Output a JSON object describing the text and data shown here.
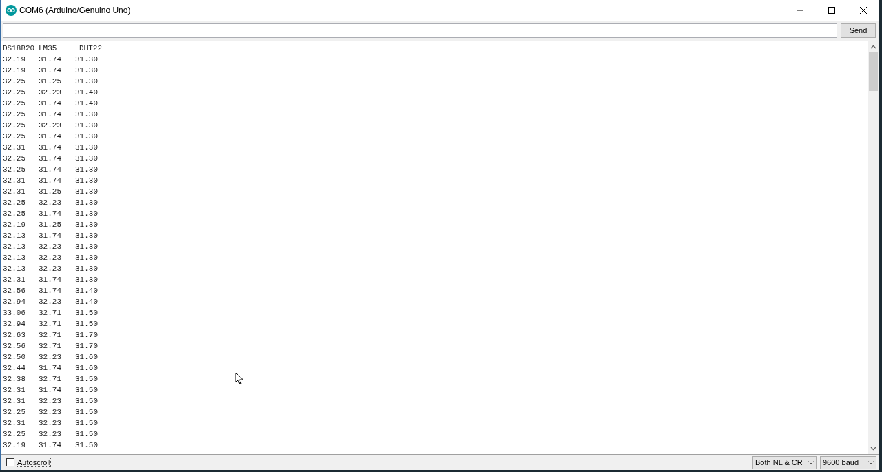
{
  "window": {
    "title": "COM6 (Arduino/Genuino Uno)"
  },
  "send_button": "Send",
  "output": {
    "header": [
      "DS18B20",
      "LM35",
      "DHT22"
    ],
    "rows": [
      [
        "32.19",
        "31.74",
        "31.30"
      ],
      [
        "32.19",
        "31.74",
        "31.30"
      ],
      [
        "32.25",
        "31.25",
        "31.30"
      ],
      [
        "32.25",
        "32.23",
        "31.40"
      ],
      [
        "32.25",
        "31.74",
        "31.40"
      ],
      [
        "32.25",
        "31.74",
        "31.30"
      ],
      [
        "32.25",
        "32.23",
        "31.30"
      ],
      [
        "32.25",
        "31.74",
        "31.30"
      ],
      [
        "32.31",
        "31.74",
        "31.30"
      ],
      [
        "32.25",
        "31.74",
        "31.30"
      ],
      [
        "32.25",
        "31.74",
        "31.30"
      ],
      [
        "32.31",
        "31.74",
        "31.30"
      ],
      [
        "32.31",
        "31.25",
        "31.30"
      ],
      [
        "32.25",
        "32.23",
        "31.30"
      ],
      [
        "32.25",
        "31.74",
        "31.30"
      ],
      [
        "32.19",
        "31.25",
        "31.30"
      ],
      [
        "32.13",
        "31.74",
        "31.30"
      ],
      [
        "32.13",
        "32.23",
        "31.30"
      ],
      [
        "32.13",
        "32.23",
        "31.30"
      ],
      [
        "32.13",
        "32.23",
        "31.30"
      ],
      [
        "32.31",
        "31.74",
        "31.30"
      ],
      [
        "32.56",
        "31.74",
        "31.40"
      ],
      [
        "32.94",
        "32.23",
        "31.40"
      ],
      [
        "33.06",
        "32.71",
        "31.50"
      ],
      [
        "32.94",
        "32.71",
        "31.50"
      ],
      [
        "32.63",
        "32.71",
        "31.70"
      ],
      [
        "32.56",
        "32.71",
        "31.70"
      ],
      [
        "32.50",
        "32.23",
        "31.60"
      ],
      [
        "32.44",
        "31.74",
        "31.60"
      ],
      [
        "32.38",
        "32.71",
        "31.50"
      ],
      [
        "32.31",
        "31.74",
        "31.50"
      ],
      [
        "32.31",
        "32.23",
        "31.50"
      ],
      [
        "32.25",
        "32.23",
        "31.50"
      ],
      [
        "32.31",
        "32.23",
        "31.50"
      ],
      [
        "32.25",
        "32.23",
        "31.50"
      ],
      [
        "32.19",
        "31.74",
        "31.50"
      ]
    ]
  },
  "autoscroll": {
    "label": "Autoscroll",
    "checked": false
  },
  "line_ending": "Both NL & CR",
  "baud_rate": "9600 baud"
}
